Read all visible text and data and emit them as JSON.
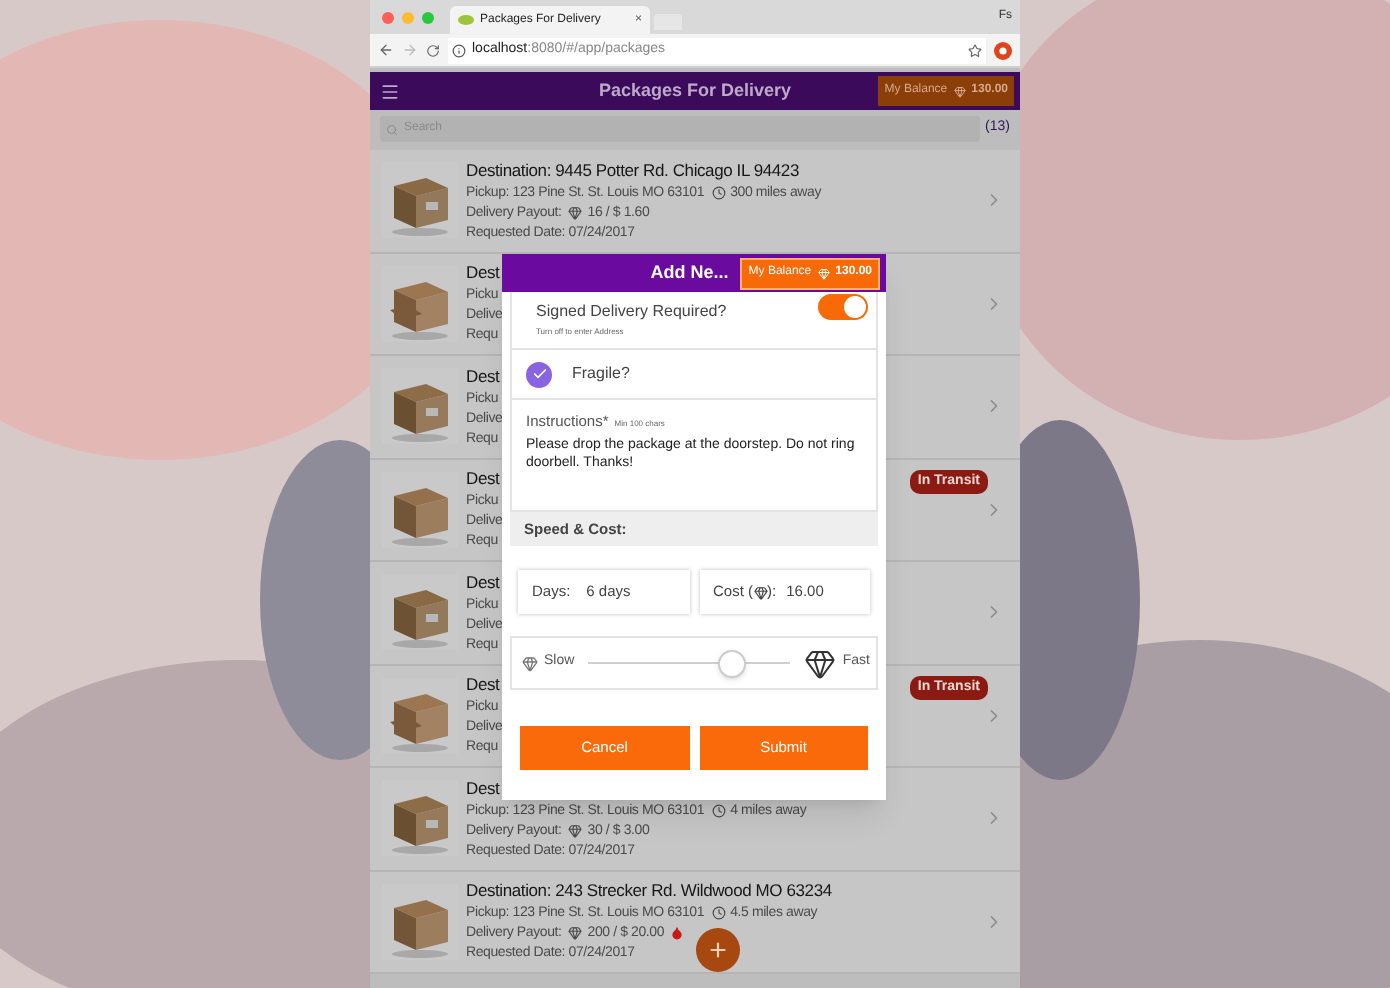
{
  "browser": {
    "tab_title": "Packages For Delivery",
    "tab_close": "×",
    "profile": "Fs",
    "url_host": "localhost",
    "url_path": ":8080/#/app/packages"
  },
  "header": {
    "title": "Packages For Delivery",
    "balance_label": "My Balance",
    "balance_value": "130.00"
  },
  "search": {
    "placeholder": "Search",
    "count": "(13)"
  },
  "packages": [
    {
      "destination": "Destination: 9445 Potter Rd. Chicago IL 94423",
      "pickup": "Pickup: 123 Pine St. St. Louis MO 63101",
      "distance": "300 miles away",
      "payout_label": "Delivery Payout:",
      "payout": "16 / $ 1.60",
      "date": "Requested Date: 07/24/2017",
      "urgent": false
    },
    {
      "destination": "Dest",
      "pickup": "Picku",
      "payout_label": "Delive",
      "date": "Requ",
      "urgent": false
    },
    {
      "destination": "Dest",
      "pickup": "Picku",
      "payout_label": "Delive",
      "date": "Requ",
      "urgent": false
    },
    {
      "destination": "Dest",
      "pickup": "Picku",
      "payout_label": "Delive",
      "date": "Requ",
      "status": "In Transit",
      "urgent": false
    },
    {
      "destination": "Dest",
      "pickup": "Picku",
      "payout_label": "Delive",
      "date": "Requ",
      "urgent": false
    },
    {
      "destination": "Dest",
      "pickup": "Picku",
      "payout_label": "Delive",
      "date": "Requ",
      "status": "In Transit",
      "urgent": false
    },
    {
      "destination": "Dest",
      "pickup": "Pickup: 123 Pine St. St. Louis MO 63101",
      "distance": "4 miles away",
      "payout_label": "Delivery Payout:",
      "payout": "30 / $ 3.00",
      "date": "Requested Date: 07/24/2017",
      "urgent": false
    },
    {
      "destination": "Destination: 243 Strecker Rd. Wildwood MO 63234",
      "pickup": "Pickup: 123 Pine St. St. Louis MO 63101",
      "distance": "4.5 miles away",
      "payout_label": "Delivery Payout:",
      "payout": "200 / $ 20.00",
      "date": "Requested Date: 07/24/2017",
      "urgent": true
    }
  ],
  "modal": {
    "title": "Add Ne...",
    "balance_label": "My Balance",
    "balance_value": "130.00",
    "signed": {
      "label": "Signed Delivery Required?",
      "hint": "Turn off to enter Address",
      "on": true
    },
    "fragile": {
      "label": "Fragile?",
      "checked": true
    },
    "instructions": {
      "label": "Instructions*",
      "hint": "Min 100 chars",
      "value": "Please drop the package at the doorstep. Do not ring doorbell. Thanks!"
    },
    "section": "Speed & Cost:",
    "days": {
      "label": "Days:",
      "value": "6 days"
    },
    "cost": {
      "label_before": "Cost (",
      "label_after": "):",
      "value": "16.00"
    },
    "speed": {
      "slow": "Slow",
      "fast": "Fast",
      "level": 0.74
    },
    "buttons": [
      "Cancel",
      "Submit"
    ]
  },
  "fab": "+"
}
